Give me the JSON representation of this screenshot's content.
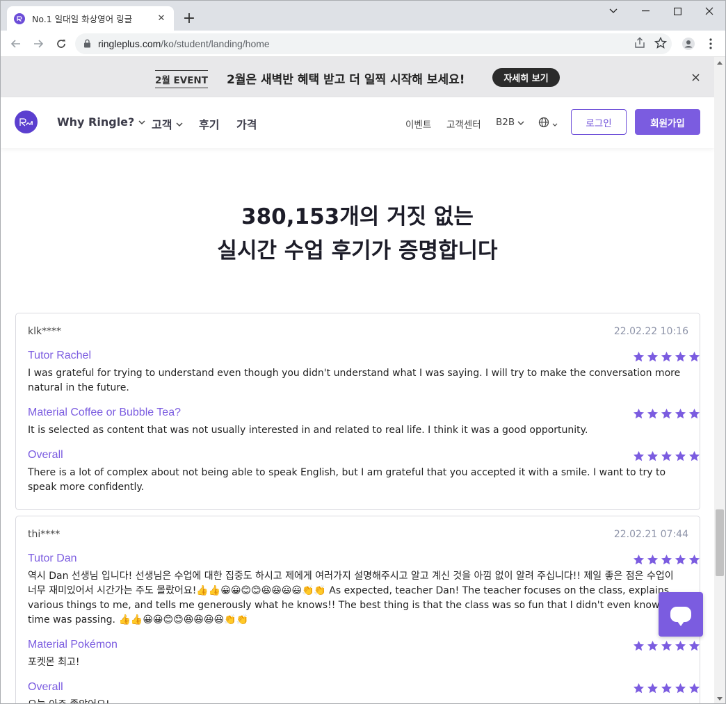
{
  "browser": {
    "tab_title": "No.1 일대일 화상영어 링글",
    "url_host": "ringleplus.com",
    "url_path": "/ko/student/landing/home"
  },
  "banner": {
    "tag": "2월 EVENT",
    "text": "2월은 새벽반 혜택 받고 더 일찍 시작해 보세요!",
    "button": "자세히 보기"
  },
  "nav": {
    "logo_text": "Ringle",
    "why": "Why Ringle?",
    "customers": "고객",
    "reviews": "후기",
    "pricing": "가격",
    "events": "이벤트",
    "support": "고객센터",
    "b2b": "B2B",
    "login": "로그인",
    "signup": "회원가입"
  },
  "headline": {
    "line1": "380,153개의 거짓 없는",
    "line2": "실시간 수업 후기가 증명합니다"
  },
  "reviews": [
    {
      "user": "klk****",
      "date": "22.02.22 10:16",
      "sections": [
        {
          "label": "Tutor Rachel",
          "stars": 5,
          "text": "I was grateful for trying to understand even though you didn't understand what I was saying. I will try to make the conversation more natural in the future."
        },
        {
          "label": "Material Coffee or Bubble Tea?",
          "stars": 5,
          "text": "It is selected as content that was not usually interested in and related to real life. I think it was a good opportunity."
        },
        {
          "label": "Overall",
          "stars": 5,
          "text": "There is a lot of complex about not being able to speak English, but I am grateful that you accepted it with a smile. I want to try to speak more confidently."
        }
      ]
    },
    {
      "user": "thi****",
      "date": "22.02.21 07:44",
      "sections": [
        {
          "label": "Tutor Dan",
          "stars": 5,
          "text": "역시 Dan 선생님 입니다! 선생님은 수업에 대한 집중도 하시고 제에게 여러가지 설명해주시고 알고 계신 것을 아낌 없이 알려 주십니다!! 제일 좋은 점은 수업이 너무 재미있어서 시간가는 주도 몰랐어요!👍👍😀😀😊😊😆😆😃😃👏👏 As expected, teacher Dan! The teacher focuses on the class, explains various things to me, and tells me generously what he knows!! The best thing is that the class was so fun that I didn't even know the time was passing. 👍👍😀😀😊😊😆😆😃😃👏👏"
        },
        {
          "label": "Material Pokémon",
          "stars": 5,
          "text": "포켓몬 최고!"
        },
        {
          "label": "Overall",
          "stars": 5,
          "text": "오늘 아주 좋았어요!"
        }
      ]
    }
  ],
  "colors": {
    "accent": "#7b5ce0",
    "banner_bg": "#e8e8ea",
    "date": "#8d93a8"
  }
}
